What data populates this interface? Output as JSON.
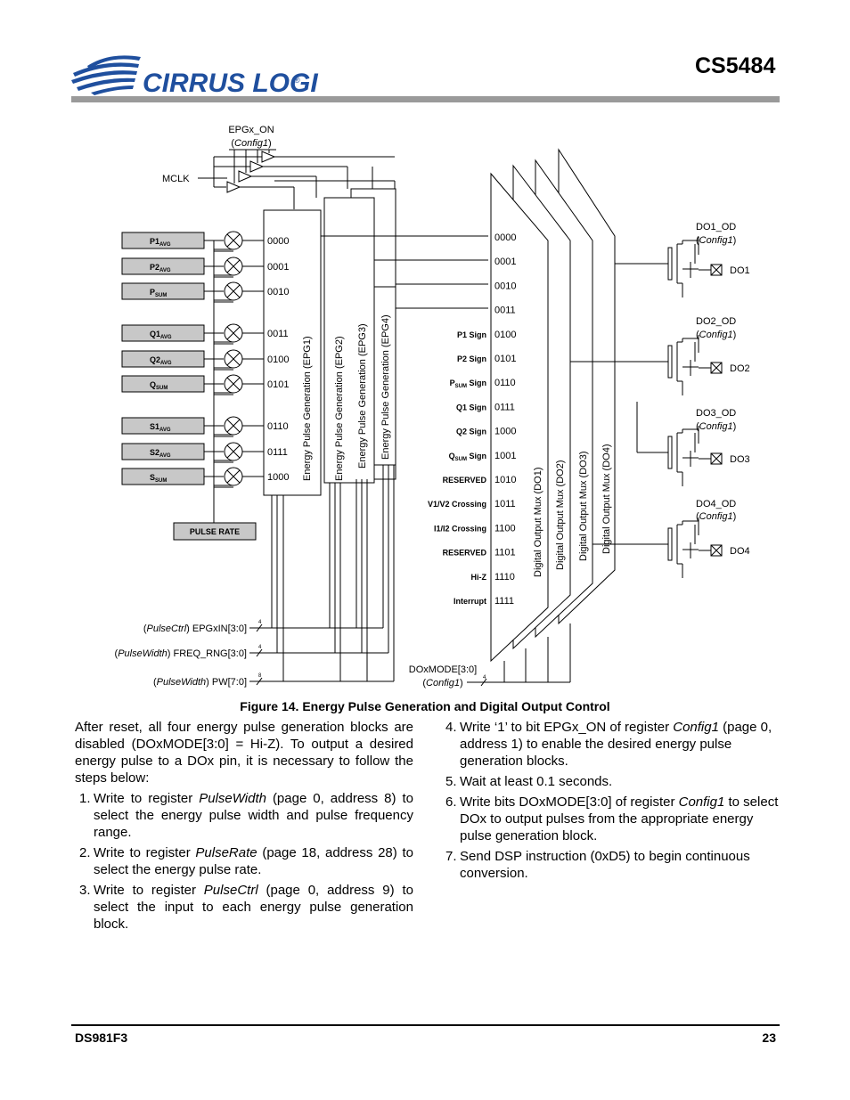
{
  "header": {
    "company": "CIRRUS LOGIC",
    "registered": "®",
    "part_number": "CS5484"
  },
  "figure": {
    "caption": "Figure 14.  Energy Pulse Generation and Digital Output Control",
    "epgx_on": {
      "label": "EPGx_ON",
      "reg": "Config1"
    },
    "mclk": "MCLK",
    "inputs": [
      {
        "main": "P1",
        "sub": "AVG",
        "code": "0000"
      },
      {
        "main": "P2",
        "sub": "AVG",
        "code": "0001"
      },
      {
        "main": "P",
        "sub": "SUM",
        "code": "0010"
      },
      {
        "main": "Q1",
        "sub": "AVG",
        "code": "0011"
      },
      {
        "main": "Q2",
        "sub": "AVG",
        "code": "0100"
      },
      {
        "main": "Q",
        "sub": "SUM",
        "code": "0101"
      },
      {
        "main": "S1",
        "sub": "AVG",
        "code": "0110"
      },
      {
        "main": "S2",
        "sub": "AVG",
        "code": "0111"
      },
      {
        "main": "S",
        "sub": "SUM",
        "code": "1000"
      }
    ],
    "pulse_rate": "PULSE RATE",
    "epg_blocks": [
      "Energy Pulse Generation (EPG1)",
      "Energy Pulse Generation (EPG2)",
      "Energy Pulse Generation (EPG3)",
      "Energy Pulse Generation (EPG4)"
    ],
    "mux_blocks": [
      "Digital Output Mux (DO1)",
      "Digital Output Mux (DO2)",
      "Digital Output Mux (DO3)",
      "Digital Output Mux (DO4)"
    ],
    "mux_rows": [
      {
        "label": "",
        "code": "0000"
      },
      {
        "label": "",
        "code": "0001"
      },
      {
        "label": "",
        "code": "0010"
      },
      {
        "label": "",
        "code": "0011"
      },
      {
        "label": "P1 Sign",
        "code": "0100"
      },
      {
        "label": "P2 Sign",
        "code": "0101"
      },
      {
        "label": "P",
        "sub": "SUM",
        "suffix": " Sign",
        "code": "0110"
      },
      {
        "label": "Q1 Sign",
        "code": "0111"
      },
      {
        "label": "Q2 Sign",
        "code": "1000"
      },
      {
        "label": "Q",
        "sub": "SUM",
        "suffix": " Sign",
        "code": "1001"
      },
      {
        "label": "RESERVED",
        "code": "1010"
      },
      {
        "label": "V1/V2 Crossing",
        "code": "1011"
      },
      {
        "label": "I1/I2 Crossing",
        "code": "1100"
      },
      {
        "label": "RESERVED",
        "code": "1101"
      },
      {
        "label": "Hi-Z",
        "code": "1110"
      },
      {
        "label": "Interrupt",
        "code": "1111"
      }
    ],
    "outputs": [
      {
        "od": "DO1_OD",
        "reg": "Config1",
        "pin": "DO1"
      },
      {
        "od": "DO2_OD",
        "reg": "Config1",
        "pin": "DO2"
      },
      {
        "od": "DO3_OD",
        "reg": "Config1",
        "pin": "DO3"
      },
      {
        "od": "DO4_OD",
        "reg": "Config1",
        "pin": "DO4"
      }
    ],
    "bus_inputs": [
      {
        "reg": "PulseCtrl",
        "field": " EPGxIN[3:0]",
        "width": "4"
      },
      {
        "reg": "PulseWidth",
        "field": " FREQ_RNG[3:0]",
        "width": "4"
      },
      {
        "reg": "PulseWidth",
        "field": " PW[7:0]",
        "width": "8"
      }
    ],
    "doxmode": {
      "field": "DOxMODE[3:0]",
      "reg": "Config1",
      "width": "4"
    }
  },
  "body": {
    "left_intro": "After reset, all four energy pulse generation blocks are disabled (DOxMODE[3:0] = Hi-Z). To output a desired energy pulse to a DOx pin, it is necessary to follow the steps below:",
    "steps": [
      {
        "n": "1.",
        "pre": "Write to register ",
        "em": "PulseWidth",
        "post": " (page 0, address 8) to select the energy pulse width and pulse frequency range."
      },
      {
        "n": "2.",
        "pre": "Write to register ",
        "em": "PulseRate",
        "post": " (page 18, address 28) to select the energy pulse rate."
      },
      {
        "n": "3.",
        "pre": "Write to register ",
        "em": "PulseCtrl",
        "post": " (page 0, address 9) to select the input to each energy pulse generation block."
      },
      {
        "n": "4.",
        "pre": "Write ‘1’ to bit EPGx_ON of register ",
        "em": "Config1",
        "post": " (page 0, address 1) to enable the desired energy pulse generation blocks."
      },
      {
        "n": "5.",
        "pre": "Wait at least 0.1 seconds.",
        "em": "",
        "post": ""
      },
      {
        "n": "6.",
        "pre": "Write bits DOxMODE[3:0] of register ",
        "em": "Config1",
        "post": " to select DOx to output pulses from the appropriate energy pulse generation block."
      },
      {
        "n": "7.",
        "pre": "Send DSP instruction (0xD5) to begin continuous conversion.",
        "em": "",
        "post": ""
      }
    ]
  },
  "footer": {
    "doc_id": "DS981F3",
    "page": "23"
  }
}
